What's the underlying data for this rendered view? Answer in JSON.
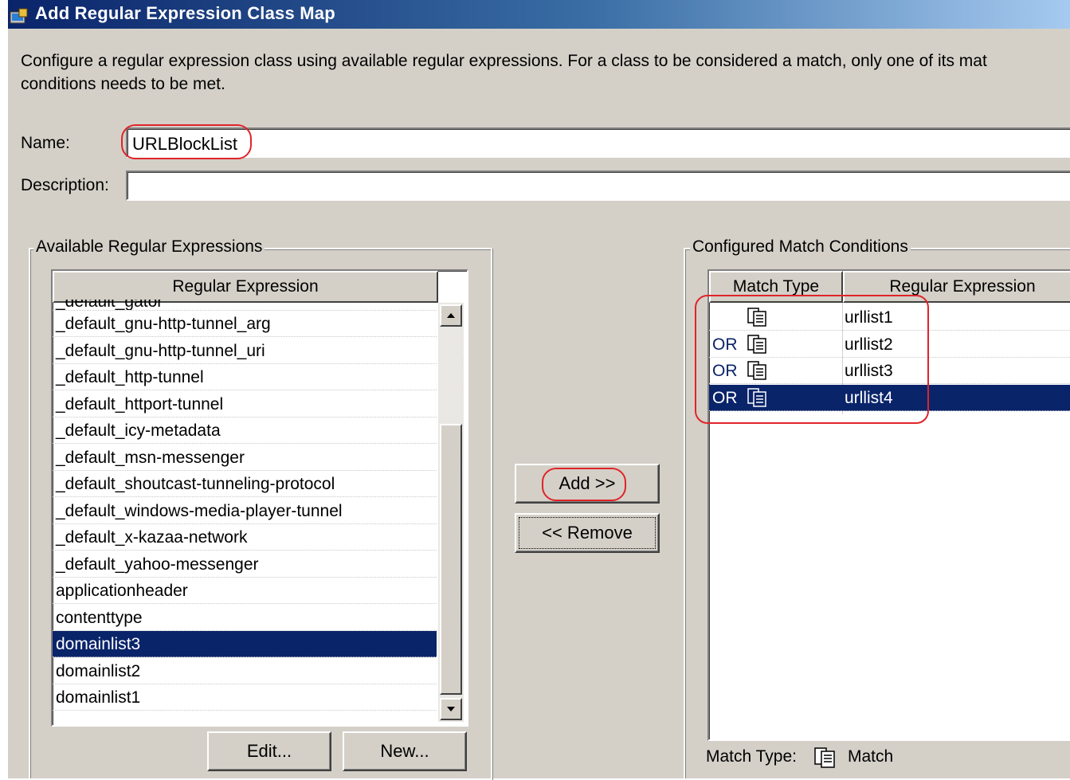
{
  "window": {
    "title": "Add Regular Expression Class Map"
  },
  "instructions": "Configure a regular expression class using available regular expressions. For a class to be considered a match, only one of its mat\nconditions needs to be met.",
  "form": {
    "name_label": "Name:",
    "name_value": "URLBlockList",
    "description_label": "Description:",
    "description_value": ""
  },
  "available": {
    "group_title": "Available Regular Expressions",
    "column_header": "Regular Expression",
    "partial_top_item": "_default_gator",
    "items": [
      "_default_gnu-http-tunnel_arg",
      "_default_gnu-http-tunnel_uri",
      "_default_http-tunnel",
      "_default_httport-tunnel",
      "_default_icy-metadata",
      "_default_msn-messenger",
      "_default_shoutcast-tunneling-protocol",
      "_default_windows-media-player-tunnel",
      "_default_x-kazaa-network",
      "_default_yahoo-messenger",
      "applicationheader",
      "contenttype",
      "domainlist3",
      "domainlist2",
      "domainlist1"
    ],
    "selected_item": "domainlist3",
    "edit_button": "Edit...",
    "new_button": "New..."
  },
  "actions": {
    "add_button": "Add >>",
    "remove_button": "<< Remove"
  },
  "configured": {
    "group_title": "Configured Match Conditions",
    "headers": [
      "Match Type",
      "Regular Expression"
    ],
    "rows": [
      {
        "prefix": "",
        "expression": "urllist1"
      },
      {
        "prefix": "OR",
        "expression": "urllist2"
      },
      {
        "prefix": "OR",
        "expression": "urllist3"
      },
      {
        "prefix": "OR",
        "expression": "urllist4"
      }
    ],
    "selected_row": "urllist4",
    "match_type_label": "Match Type:",
    "match_type_value": "Match"
  },
  "colors": {
    "selection": "#0a246a",
    "annotation": "#e0242a",
    "dialog_bg": "#d4d0c8"
  }
}
